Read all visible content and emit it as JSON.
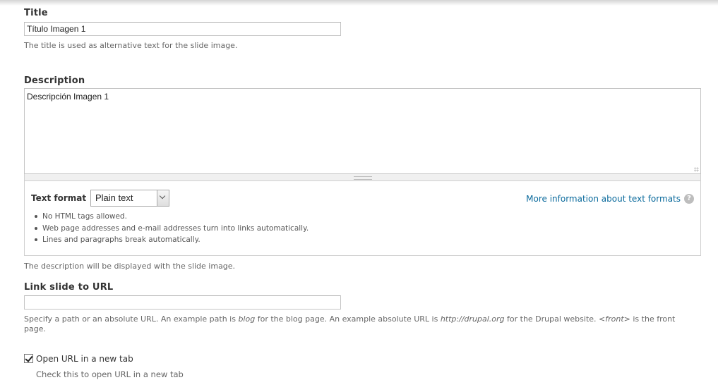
{
  "title_field": {
    "label": "Title",
    "value": "Título Imagen 1",
    "help": "The title is used as alternative text for the slide image."
  },
  "description_field": {
    "label": "Description",
    "value": "Descripción Imagen 1",
    "help": "The description will be displayed with the slide image."
  },
  "text_format": {
    "label": "Text format",
    "selected": "Plain text",
    "more_info_link": "More information about text formats",
    "help_icon": "question-icon",
    "tips": [
      "No HTML tags allowed.",
      "Web page addresses and e-mail addresses turn into links automatically.",
      "Lines and paragraphs break automatically."
    ]
  },
  "link_field": {
    "label": "Link slide to URL",
    "value": "",
    "help_parts": {
      "p1": "Specify a path or an absolute URL. An example path is ",
      "example_path": "blog",
      "p2": " for the blog page. An example absolute URL is ",
      "example_url": "http://drupal.org",
      "p3": " for the Drupal website. ",
      "front": "<front>",
      "p4": " is the front page."
    }
  },
  "new_tab": {
    "label": "Open URL in a new tab",
    "checked": true,
    "help": "Check this to open URL in a new tab"
  },
  "colors": {
    "link": "#0a6a9c",
    "help_text": "#666666",
    "border": "#c4c4c4"
  }
}
